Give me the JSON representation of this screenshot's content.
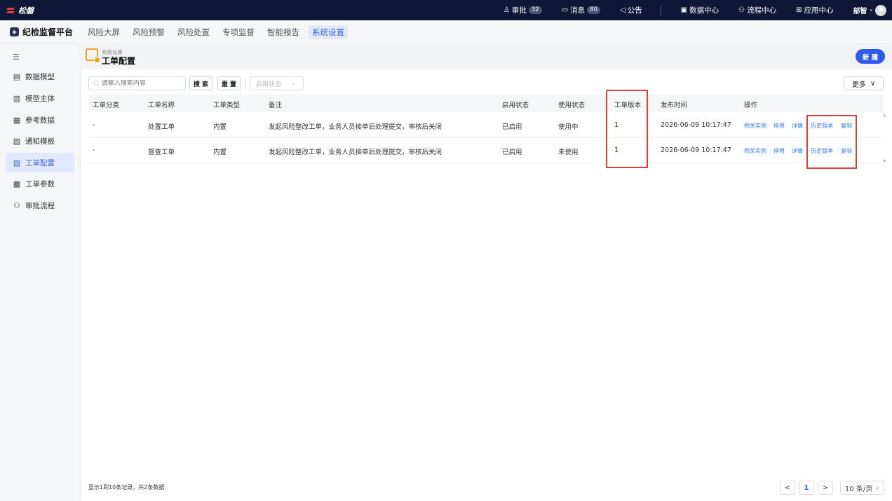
{
  "topbar": {
    "brand": "松磐",
    "items": [
      {
        "icon": "user-icon",
        "label": "审批",
        "badge": "32"
      },
      {
        "icon": "message-icon",
        "label": "消息",
        "badge": "80"
      },
      {
        "icon": "announce-icon",
        "label": "公告"
      }
    ],
    "centers": [
      {
        "icon": "data-icon",
        "label": "数据中心"
      },
      {
        "icon": "flow-icon",
        "label": "流程中心"
      },
      {
        "icon": "app-icon",
        "label": "应用中心"
      }
    ],
    "user": "部智"
  },
  "nav": {
    "platform": "纪检监督平台",
    "tabs": [
      "风险大屏",
      "风险预警",
      "风险处置",
      "专项监督",
      "智能报告",
      "系统设置"
    ],
    "active_tab": "系统设置"
  },
  "sidebar": {
    "items": [
      {
        "label": "数据模型",
        "icon": "data-model-icon"
      },
      {
        "label": "模型主体",
        "icon": "building-icon"
      },
      {
        "label": "参考数据",
        "icon": "reference-icon"
      },
      {
        "label": "通知模板",
        "icon": "template-icon"
      },
      {
        "label": "工单配置",
        "icon": "ticket-config-icon",
        "active": true
      },
      {
        "label": "工单参数",
        "icon": "ticket-param-icon"
      },
      {
        "label": "审批流程",
        "icon": "approval-flow-icon"
      }
    ]
  },
  "page": {
    "breadcrumb": "系统设置",
    "title": "工单配置",
    "new_label": "新 建"
  },
  "toolbar": {
    "search_placeholder": "请输入搜索内容",
    "search_label": "搜 索",
    "reset_label": "重 置",
    "status_placeholder": "启用状态",
    "more_label": "更多"
  },
  "table": {
    "columns": [
      "工单分类",
      "工单名称",
      "工单类型",
      "备注",
      "启用状态",
      "使用状态",
      "工单版本",
      "发布时间",
      "操作"
    ],
    "rows": [
      {
        "category": "-",
        "name": "处置工单",
        "type": "内置",
        "remark": "发起风险整改工单，业务人员接单后处理提交，审核后关闭",
        "enabled": "已启用",
        "usage": "使用中",
        "version": "1",
        "published": "2026-06-09 10:17:47"
      },
      {
        "category": "-",
        "name": "督查工单",
        "type": "内置",
        "remark": "发起风险整改工单，业务人员接单后处理提交，审核后关闭",
        "enabled": "已启用",
        "usage": "未使用",
        "version": "1",
        "published": "2026-06-09 10:17:47"
      }
    ],
    "actions": [
      "相关实例",
      "停用",
      "详情",
      "历史版本",
      "复制"
    ]
  },
  "footer": {
    "summary": "显示1到10条记录，共2条数据",
    "prev": "<",
    "current_page": "1",
    "next": ">",
    "page_size": "10 条/页"
  },
  "colors": {
    "topbar_bg": "#0f1736",
    "accent": "#2f5bea",
    "highlight": "#e23d3d",
    "link": "#3b7be6"
  }
}
